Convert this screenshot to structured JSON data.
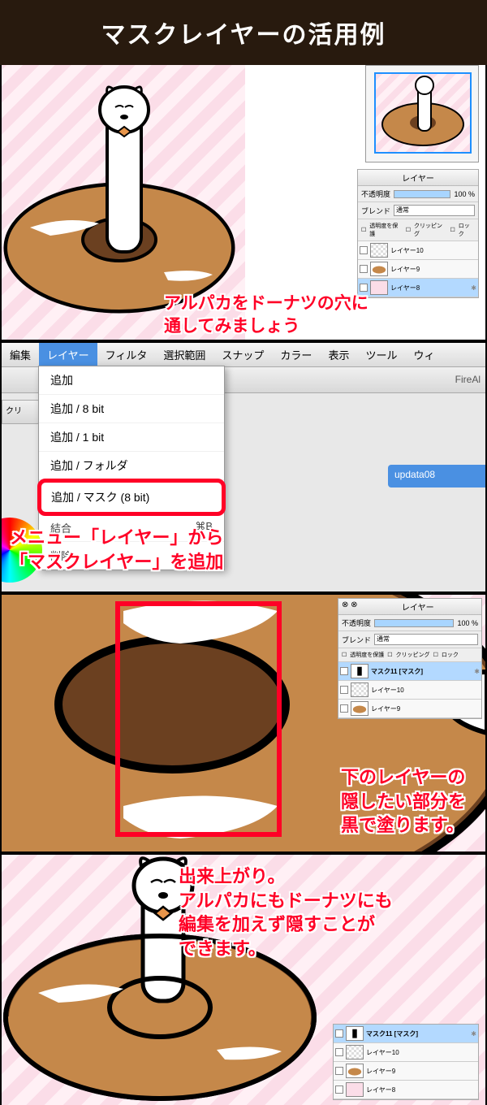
{
  "title": "マスクレイヤーの活用例",
  "panel1": {
    "annotation": "アルパカをドーナツの穴に\n通してみましょう",
    "layerPanel": {
      "title": "レイヤー",
      "opacity_label": "不透明度",
      "opacity_value": "100 %",
      "blend_label": "ブレンド",
      "blend_value": "通常",
      "protect": "透明度を保護",
      "clipping": "クリッピング",
      "lock": "ロック",
      "layers": [
        {
          "name": "レイヤー10"
        },
        {
          "name": "レイヤー9"
        },
        {
          "name": "レイヤー8",
          "selected": true
        }
      ]
    }
  },
  "panel2": {
    "menubar": [
      "編集",
      "レイヤー",
      "フィルタ",
      "選択範囲",
      "スナップ",
      "カラー",
      "表示",
      "ツール",
      "ウィ"
    ],
    "toolbar_right": "FireAl",
    "side": "クリ",
    "dropdown": [
      "追加",
      "追加 / 8 bit",
      "追加 / 1 bit",
      "追加 / フォルダ",
      "追加 / マスク (8 bit)"
    ],
    "dropdown_extra": [
      "",
      "結合",
      "削除"
    ],
    "shortcut": "⌘B",
    "tab": "updata08",
    "annotation": "メニュー「レイヤー」から\n「マスクレイヤー」を追加"
  },
  "panel3": {
    "annotation": "下のレイヤーの\n隠したい部分を\n黒で塗ります。",
    "layerPanel": {
      "title": "レイヤー",
      "opacity_label": "不透明度",
      "opacity_value": "100 %",
      "blend_label": "ブレンド",
      "blend_value": "通常",
      "protect": "透明度を保護",
      "clipping": "クリッピング",
      "lock": "ロック",
      "layers": [
        {
          "name": "マスク11 [マスク]",
          "selected": true
        },
        {
          "name": "レイヤー10"
        },
        {
          "name": "レイヤー9"
        }
      ]
    }
  },
  "panel4": {
    "annotation": "出来上がり。\nアルパカにもドーナツにも\n編集を加えず隠すことが\nできます。",
    "layerPanel": {
      "layers": [
        {
          "name": "マスク11 [マスク]",
          "selected": true
        },
        {
          "name": "レイヤー10"
        },
        {
          "name": "レイヤー9"
        },
        {
          "name": "レイヤー8"
        }
      ]
    }
  }
}
